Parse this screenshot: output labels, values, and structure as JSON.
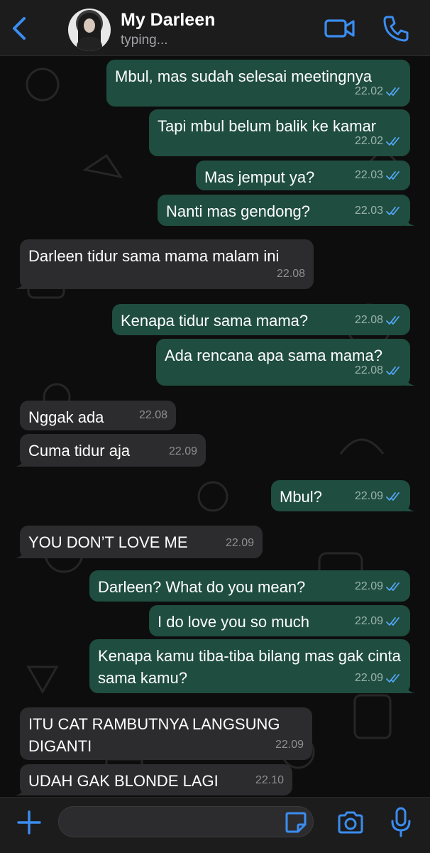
{
  "header": {
    "contact_name": "My Darleen",
    "status": "typing...",
    "back_icon": "chevron-left-icon",
    "video_icon": "video-camera-icon",
    "call_icon": "phone-icon"
  },
  "colors": {
    "accent": "#3b8df0",
    "outgoing_bubble": "#1f4d3f",
    "incoming_bubble": "#2c2c2e",
    "read_ticks": "#53a6f5"
  },
  "messages": [
    {
      "direction": "out",
      "text": "Mbul, mas sudah selesai meetingnya",
      "time": "22.02",
      "status": "read"
    },
    {
      "direction": "out",
      "text": "Tapi mbul belum balik ke kamar",
      "time": "22.02",
      "status": "read"
    },
    {
      "direction": "out",
      "text": "Mas jemput ya?",
      "time": "22.03",
      "status": "read"
    },
    {
      "direction": "out",
      "text": "Nanti mas gendong?",
      "time": "22.03",
      "status": "read"
    },
    {
      "direction": "in",
      "text": "Darleen tidur sama mama malam ini",
      "time": "22.08"
    },
    {
      "direction": "out",
      "text": "Kenapa tidur sama mama?",
      "time": "22.08",
      "status": "read"
    },
    {
      "direction": "out",
      "text": "Ada rencana apa sama mama?",
      "time": "22.08",
      "status": "read"
    },
    {
      "direction": "in",
      "text": "Nggak ada",
      "time": "22.08"
    },
    {
      "direction": "in",
      "text": "Cuma tidur aja",
      "time": "22.09"
    },
    {
      "direction": "out",
      "text": "Mbul?",
      "time": "22.09",
      "status": "read"
    },
    {
      "direction": "in",
      "text": "YOU DON’T LOVE ME",
      "time": "22.09"
    },
    {
      "direction": "out",
      "text": "Darleen? What do you mean?",
      "time": "22.09",
      "status": "read"
    },
    {
      "direction": "out",
      "text": "I do love you so much",
      "time": "22.09",
      "status": "read"
    },
    {
      "direction": "out",
      "text": "Kenapa kamu tiba-tiba bilang mas gak cinta sama kamu?",
      "time": "22.09",
      "status": "read"
    },
    {
      "direction": "in",
      "text": "ITU CAT RAMBUTNYA LANGSUNG DIGANTI",
      "time": "22.09"
    },
    {
      "direction": "in",
      "text": "UDAH GAK BLONDE LAGI",
      "time": "22.10"
    }
  ],
  "footer": {
    "input_placeholder": "",
    "plus_icon": "plus-icon",
    "sticker_icon": "sticker-icon",
    "camera_icon": "camera-icon",
    "mic_icon": "microphone-icon"
  }
}
